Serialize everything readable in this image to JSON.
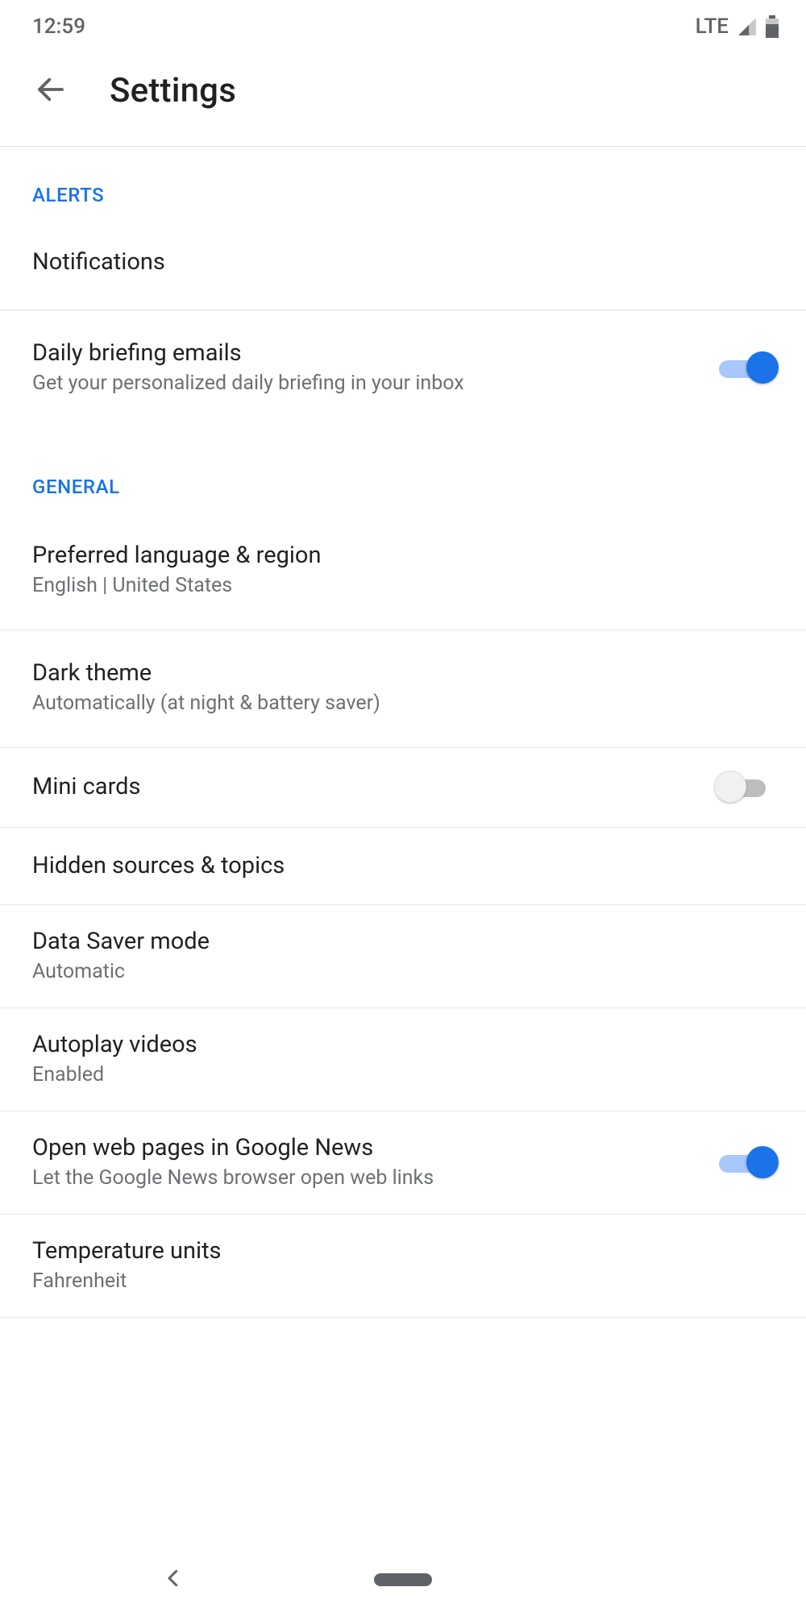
{
  "status_bar": {
    "time": "12:59",
    "network": "LTE"
  },
  "header": {
    "title": "Settings"
  },
  "sections": {
    "alerts": {
      "label": "ALERTS",
      "items": {
        "notifications": {
          "title": "Notifications"
        },
        "daily_briefing": {
          "title": "Daily briefing emails",
          "subtitle": "Get your personalized daily briefing in your inbox",
          "toggle": true
        }
      }
    },
    "general": {
      "label": "GENERAL",
      "items": {
        "language": {
          "title": "Preferred language & region",
          "subtitle": "English | United States"
        },
        "dark_theme": {
          "title": "Dark theme",
          "subtitle": "Automatically (at night & battery saver)"
        },
        "mini_cards": {
          "title": "Mini cards",
          "toggle": false
        },
        "hidden_sources": {
          "title": "Hidden sources & topics"
        },
        "data_saver": {
          "title": "Data Saver mode",
          "subtitle": "Automatic"
        },
        "autoplay": {
          "title": "Autoplay videos",
          "subtitle": "Enabled"
        },
        "open_web": {
          "title": "Open web pages in Google News",
          "subtitle": "Let the Google News browser open web links",
          "toggle": true
        },
        "temperature": {
          "title": "Temperature units",
          "subtitle": "Fahrenheit"
        }
      }
    }
  }
}
